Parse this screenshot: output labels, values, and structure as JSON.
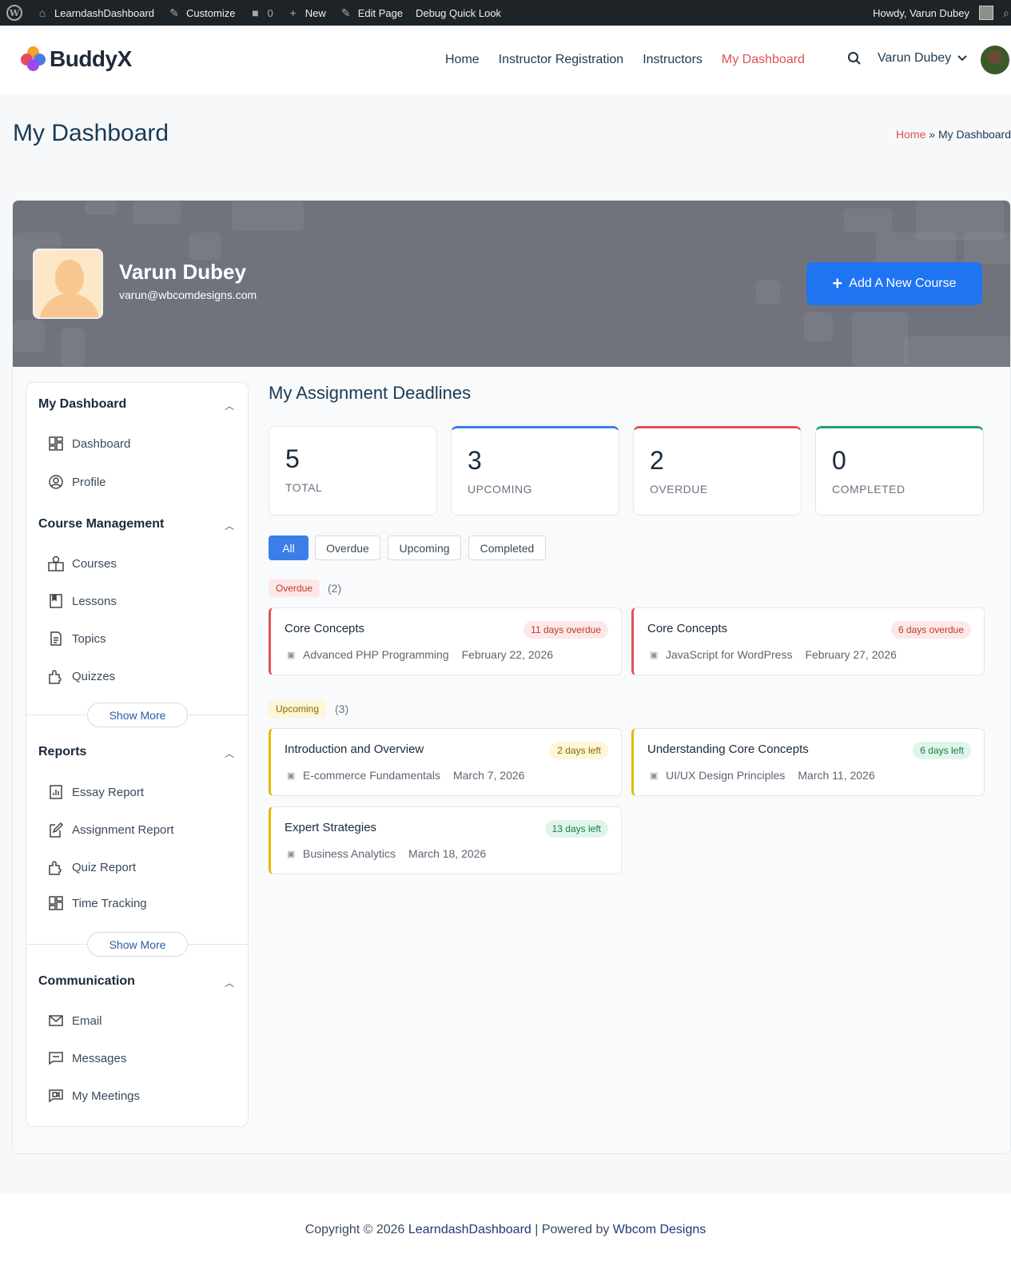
{
  "admin_bar": {
    "site_name": "LearndashDashboard",
    "customize": "Customize",
    "comments_count": "0",
    "new": "New",
    "edit_page": "Edit Page",
    "debug": "Debug Quick Look",
    "howdy": "Howdy, Varun Dubey"
  },
  "header": {
    "logo_text": "BuddyX",
    "nav": [
      "Home",
      "Instructor Registration",
      "Instructors",
      "My Dashboard"
    ],
    "user_name": "Varun Dubey"
  },
  "page": {
    "title": "My Dashboard",
    "breadcrumb_home": "Home",
    "breadcrumb_sep": "»",
    "breadcrumb_current": "My Dashboard"
  },
  "profile": {
    "name": "Varun Dubey",
    "email": "varun@wbcomdesigns.com",
    "add_course": "Add A New Course"
  },
  "sidebar": {
    "sections": [
      {
        "title": "My Dashboard",
        "items": [
          "Dashboard",
          "Profile"
        ]
      },
      {
        "title": "Course Management",
        "items": [
          "Courses",
          "Lessons",
          "Topics",
          "Quizzes"
        ],
        "show_more": "Show More"
      },
      {
        "title": "Reports",
        "items": [
          "Essay Report",
          "Assignment Report",
          "Quiz Report",
          "Time Tracking"
        ],
        "show_more": "Show More"
      },
      {
        "title": "Communication",
        "items": [
          "Email",
          "Messages",
          "My Meetings"
        ]
      }
    ]
  },
  "deadlines": {
    "title": "My Assignment Deadlines",
    "stats": [
      {
        "value": "5",
        "label": "TOTAL"
      },
      {
        "value": "3",
        "label": "UPCOMING"
      },
      {
        "value": "2",
        "label": "OVERDUE"
      },
      {
        "value": "0",
        "label": "COMPLETED"
      }
    ],
    "filters": [
      "All",
      "Overdue",
      "Upcoming",
      "Completed"
    ],
    "active_filter": "All",
    "overdue_label": "Overdue",
    "overdue_count": "(2)",
    "upcoming_label": "Upcoming",
    "upcoming_count": "(3)",
    "overdue_items": [
      {
        "title": "Core Concepts",
        "course": "Advanced PHP Programming",
        "date": "February 22, 2026",
        "status": "11 days overdue"
      },
      {
        "title": "Core Concepts",
        "course": "JavaScript for WordPress",
        "date": "February 27, 2026",
        "status": "6 days overdue"
      }
    ],
    "upcoming_items": [
      {
        "title": "Introduction and Overview",
        "course": "E-commerce Fundamentals",
        "date": "March 7, 2026",
        "status": "2 days left"
      },
      {
        "title": "Understanding Core Concepts",
        "course": "UI/UX Design Principles",
        "date": "March 11, 2026",
        "status": "6 days left"
      },
      {
        "title": "Expert Strategies",
        "course": "Business Analytics",
        "date": "March 18, 2026",
        "status": "13 days left"
      }
    ]
  },
  "footer": {
    "prefix": "Copyright © 2026",
    "site_link": "LearndashDashboard",
    "middle": "| Powered by",
    "powered_link": "Wbcom Designs"
  },
  "colors": {
    "accent_blue": "#1f74f2",
    "active_nav": "#e05252",
    "overdue": "#e05252",
    "upcoming": "#e6b800",
    "completed": "#22a06b"
  }
}
